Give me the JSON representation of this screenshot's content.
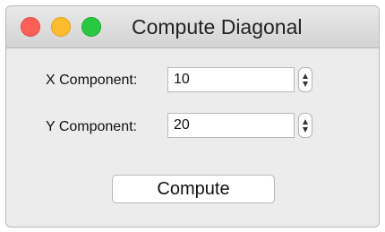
{
  "window": {
    "title": "Compute Diagonal"
  },
  "form": {
    "x_label": "X Component:",
    "x_value": "10",
    "y_label": "Y Component:",
    "y_value": "20"
  },
  "actions": {
    "compute_label": "Compute"
  },
  "colors": {
    "close": "#fc5f57",
    "minimize": "#fdbc2e",
    "zoom": "#28c840"
  }
}
